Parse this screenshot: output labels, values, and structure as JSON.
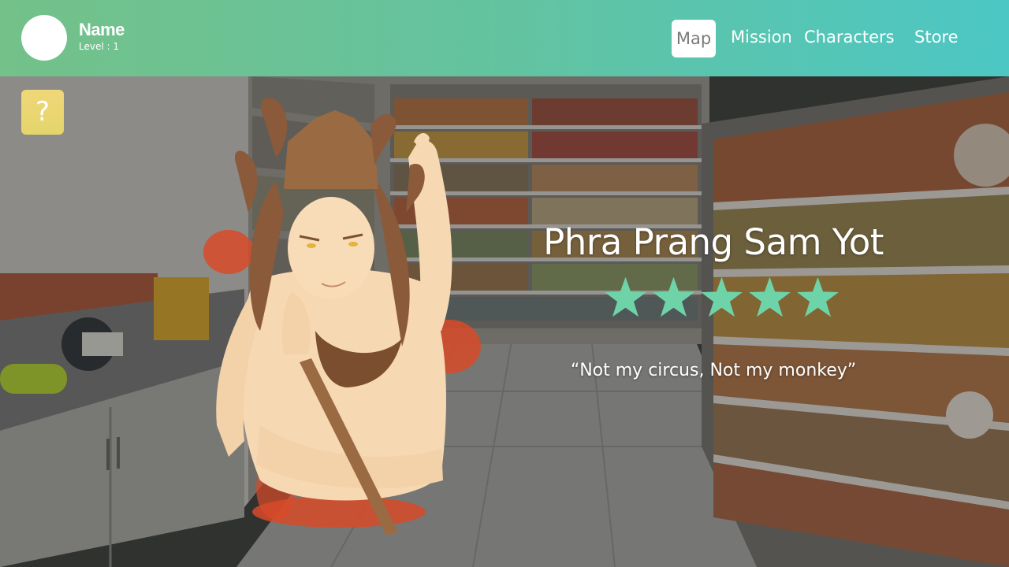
{
  "header": {
    "user": {
      "name": "Name",
      "level": "Level : 1"
    },
    "nav": {
      "map": "Map",
      "mission": "Mission",
      "characters": "Characters",
      "store": "Store"
    },
    "active_tab": "Map"
  },
  "help": {
    "label": "?"
  },
  "character": {
    "name": "Phra Prang Sam Yot",
    "rating": 5,
    "rating_max": 5,
    "quote": "“Not my circus, Not my monkey”"
  },
  "colors": {
    "header_gradient_start": "#74c189",
    "header_gradient_end": "#4cc7c4",
    "star": "#6fd3a9",
    "help_button": "#e8d670"
  },
  "icons": {
    "help": "question-mark-icon",
    "star": "star-icon"
  }
}
